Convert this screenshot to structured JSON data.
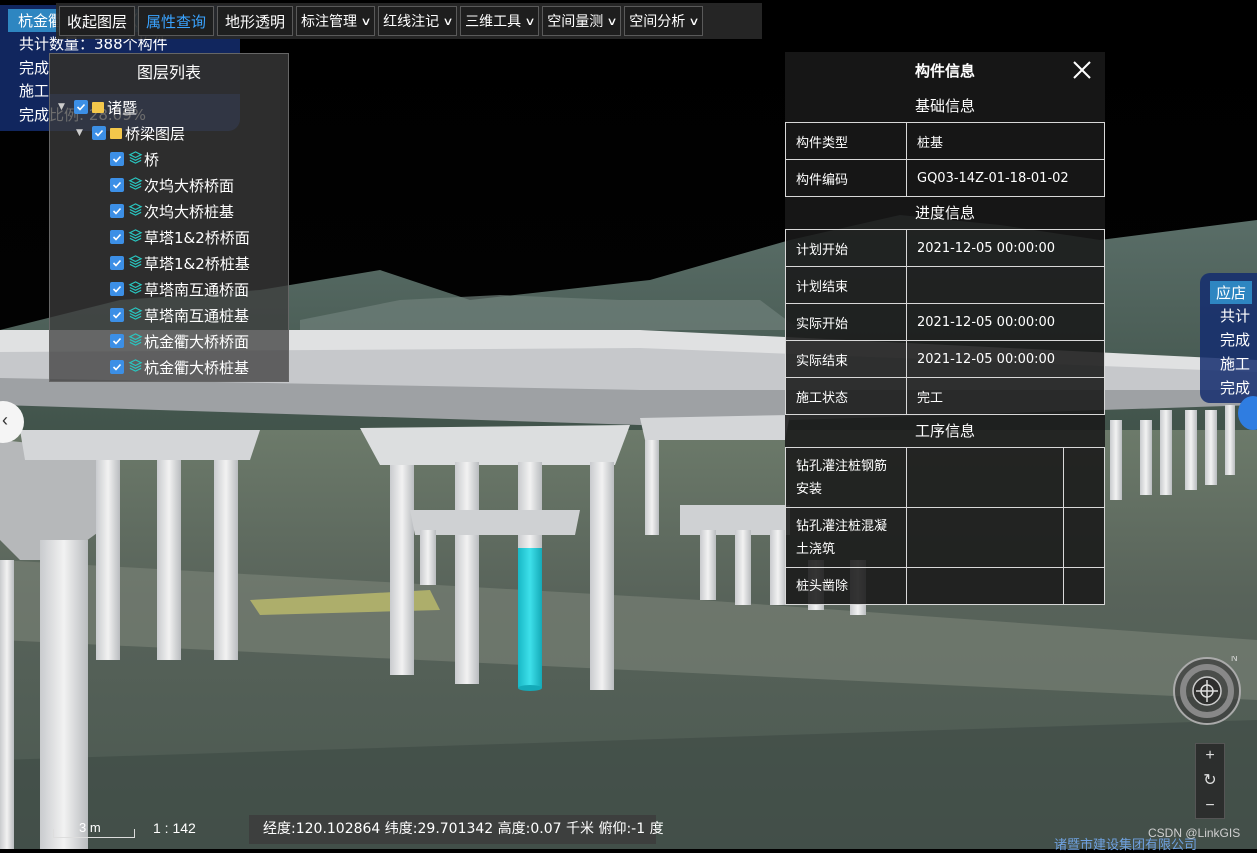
{
  "toolbar": {
    "collapse_layers": "收起图层",
    "query": "属性查询",
    "terrain_transparent": "地形透明",
    "menus": [
      "标注管理",
      "红线注记",
      "三维工具",
      "空间量测",
      "空间分析"
    ]
  },
  "summary_card": {
    "title": "杭金衢大桥桩基（右幅）",
    "total": "共计数量：388个构件",
    "completed": "完成",
    "in_progress": "施工",
    "ratio": "完成比例: 28.09%"
  },
  "layer_list": {
    "title": "图层列表",
    "root": "诸暨",
    "group": "桥梁图层",
    "layers": [
      "桥",
      "次坞大桥桥面",
      "次坞大桥桩基",
      "草塔1&2桥桥面",
      "草塔1&2桥桩基",
      "草塔南互通桥面",
      "草塔南互通桩基",
      "杭金衢大桥桥面",
      "杭金衢大桥桩基"
    ]
  },
  "info_panel": {
    "title": "构件信息",
    "basic_title": "基础信息",
    "basic": [
      {
        "k": "构件类型",
        "v": "桩基"
      },
      {
        "k": "构件编码",
        "v": "GQ03-14Z-01-18-01-02"
      }
    ],
    "progress_title": "进度信息",
    "progress": [
      {
        "k": "计划开始",
        "v": "2021-12-05 00:00:00"
      },
      {
        "k": "计划结束",
        "v": ""
      },
      {
        "k": "实际开始",
        "v": "2021-12-05 00:00:00"
      },
      {
        "k": "实际结束",
        "v": "2021-12-05 00:00:00"
      },
      {
        "k": "施工状态",
        "v": "完工"
      }
    ],
    "process_title": "工序信息",
    "processes": [
      "钻孔灌注桩钢筋安装",
      "钻孔灌注桩混凝土浇筑",
      "桩头凿除"
    ]
  },
  "right_card": {
    "title": "应店",
    "rows": [
      "共计",
      "完成",
      "施工",
      "完成"
    ]
  },
  "navigation": {
    "zoom_in": "+",
    "reset": "↻",
    "zoom_out": "−",
    "north": "N"
  },
  "status_bar": {
    "scale": "3 m",
    "ratio": "1 : 142",
    "coords": "经度:120.102864  纬度:29.701342  高度:0.07 千米  俯仰:-1 度",
    "company": "诸暨市建设集团有限公司",
    "watermark": "CSDN @LinkGIS"
  },
  "colors": {
    "accent": "#3c8fe6",
    "highlight_pile": "#1fc9d6",
    "card_blue": "#14306e"
  }
}
